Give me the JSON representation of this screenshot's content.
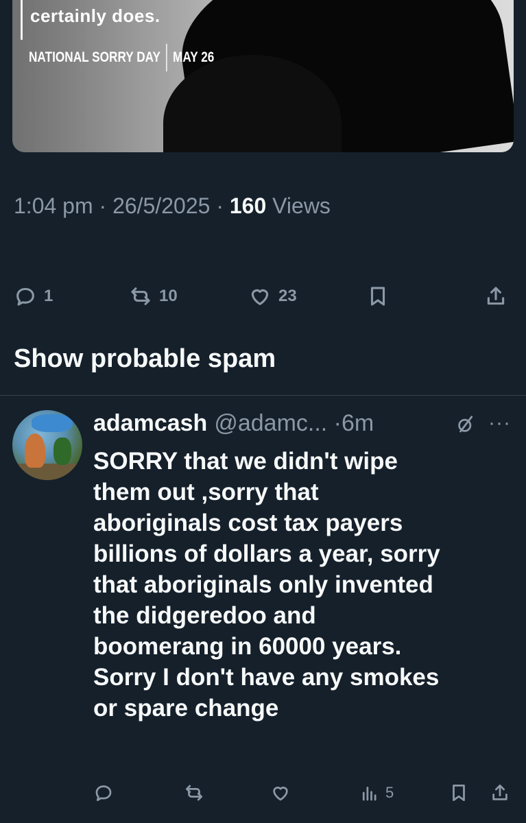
{
  "media": {
    "quote_text": "certainly does.",
    "tag_event": "NATIONAL SORRY DAY",
    "tag_date": "MAY 26"
  },
  "tweet": {
    "time": "1:04 pm",
    "date": "26/5/2025",
    "views_count": "160",
    "views_label": "Views",
    "replies": "1",
    "reposts": "10",
    "likes": "23"
  },
  "show_spam_label": "Show probable spam",
  "reply": {
    "name": "adamcash",
    "handle": "@adamc...",
    "time": "6m",
    "more": "···",
    "text": "SORRY that we didn't wipe\nthem out ,sorry that\naboriginals cost tax payers\nbillions of dollars a year, sorry\nthat aboriginals only invented\nthe didgeredoo and\nboomerang in 60000 years.\nSorry I don't have any smokes\nor spare change",
    "views": "5"
  },
  "icons": {
    "reply": "reply-icon",
    "repost": "repost-icon",
    "like": "heart-icon",
    "bookmark": "bookmark-icon",
    "share": "share-icon",
    "views": "views-icon",
    "grok": "grok-icon",
    "more": "more-icon"
  },
  "colors": {
    "background": "#15202b",
    "text": "#f7f9f9",
    "secondary": "#8b98a5",
    "divider": "#38444d"
  }
}
